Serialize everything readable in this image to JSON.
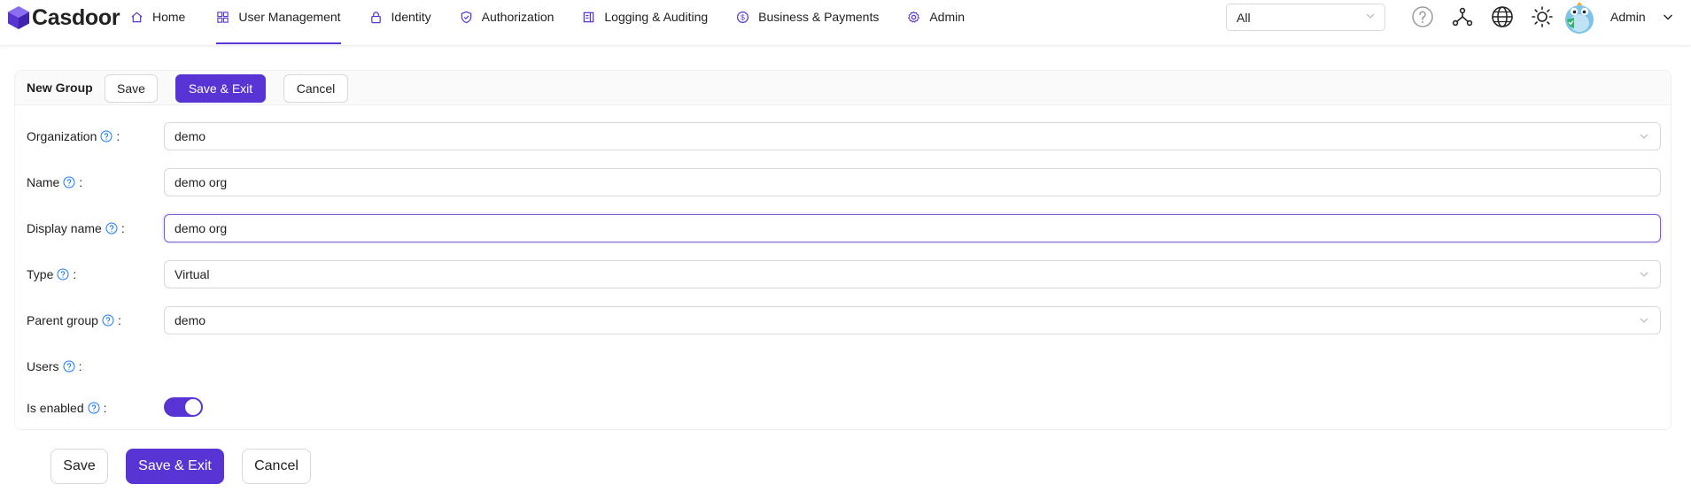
{
  "app": {
    "name": "Casdoor"
  },
  "nav": {
    "items": [
      {
        "label": "Home",
        "icon": "home-icon"
      },
      {
        "label": "User Management",
        "icon": "grid-icon",
        "active": true
      },
      {
        "label": "Identity",
        "icon": "lock-icon"
      },
      {
        "label": "Authorization",
        "icon": "shield-icon"
      },
      {
        "label": "Logging & Auditing",
        "icon": "log-icon"
      },
      {
        "label": "Business & Payments",
        "icon": "dollar-icon"
      },
      {
        "label": "Admin",
        "icon": "gear-icon"
      }
    ]
  },
  "header": {
    "org_select_value": "All",
    "user_name": "Admin",
    "icons": [
      "help-icon",
      "network-icon",
      "globe-icon",
      "sun-icon"
    ]
  },
  "form": {
    "title": "New Group",
    "top_buttons": {
      "save": "Save",
      "save_exit": "Save & Exit",
      "cancel": "Cancel"
    },
    "fields": {
      "organization": {
        "label": "Organization",
        "value": "demo"
      },
      "name": {
        "label": "Name",
        "value": "demo org"
      },
      "display_name": {
        "label": "Display name",
        "value": "demo org"
      },
      "type": {
        "label": "Type",
        "value": "Virtual"
      },
      "parent_group": {
        "label": "Parent group",
        "value": "demo"
      },
      "users": {
        "label": "Users"
      },
      "is_enabled": {
        "label": "Is enabled",
        "value": true
      }
    },
    "bottom_buttons": {
      "save": "Save",
      "save_exit": "Save & Exit",
      "cancel": "Cancel"
    }
  },
  "colors": {
    "accent": "#5734d3",
    "help_icon": "#1677ff"
  }
}
